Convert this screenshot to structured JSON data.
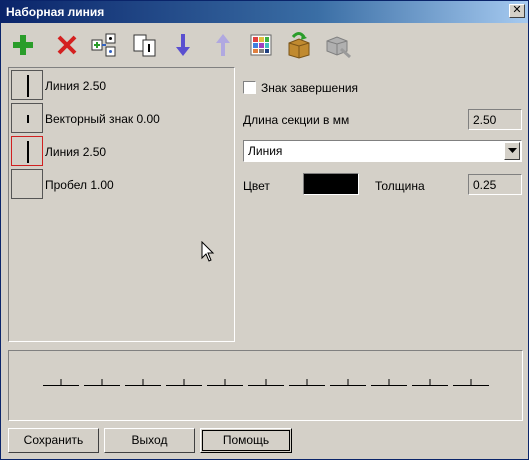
{
  "window": {
    "title": "Наборная линия",
    "close_glyph": "✕"
  },
  "toolbar": {
    "buttons": [
      {
        "name": "add-icon",
        "color": "#2a9d2a"
      },
      {
        "name": "delete-icon",
        "color": "#d42020"
      },
      {
        "name": "insert-symbol-icon",
        "color": "#3060c0"
      },
      {
        "name": "insert-vector-icon",
        "color": "#000000"
      },
      {
        "name": "move-down-icon",
        "color": "#5a4fd0"
      },
      {
        "name": "move-up-icon",
        "color": "#b0a8e0"
      },
      {
        "name": "palette-icon",
        "color": "#e04040"
      },
      {
        "name": "import-box-icon",
        "color": "#c08a30"
      },
      {
        "name": "export-disabled-icon",
        "color": "#9a9a9a"
      }
    ]
  },
  "elements_list": [
    {
      "label": "Линия 2.50",
      "kind": "line",
      "selected": false
    },
    {
      "label": "Векторный знак 0.00",
      "kind": "vector",
      "selected": false
    },
    {
      "label": "Линия 2.50",
      "kind": "line",
      "selected": true
    },
    {
      "label": "Пробел 1.00",
      "kind": "space",
      "selected": false
    }
  ],
  "properties": {
    "finish_sign_label": "Знак завершения",
    "finish_sign_checked": false,
    "section_length_label": "Длина секции в мм",
    "section_length_value": "2.50",
    "type_selected": "Линия",
    "color_label": "Цвет",
    "color_value": "#000000",
    "thickness_label": "Толщина",
    "thickness_value": "0.25"
  },
  "buttons": {
    "save": "Сохранить",
    "exit": "Выход",
    "help": "Помощь"
  }
}
